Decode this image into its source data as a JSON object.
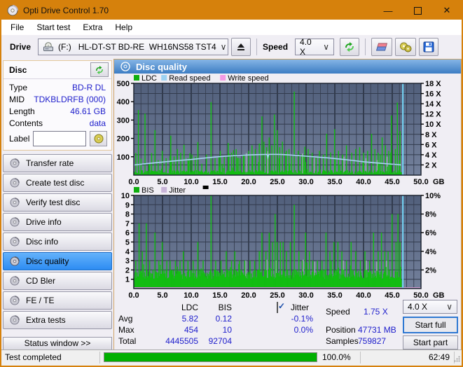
{
  "window": {
    "title": "Opti Drive Control 1.70"
  },
  "icons": {
    "minimize": "—",
    "close": "✕",
    "chevron": "∨"
  },
  "menu": {
    "items": [
      "File",
      "Start test",
      "Extra",
      "Help"
    ]
  },
  "toolbar": {
    "drive_label": "Drive",
    "drive_value": "(F:)   HL-DT-ST BD-RE  WH16NS58 TST4",
    "speed_label": "Speed",
    "speed_value": "4.0 X"
  },
  "disc_panel": {
    "title": "Disc",
    "rows": [
      {
        "label": "Type",
        "value": "BD-R DL"
      },
      {
        "label": "MID",
        "value": "TDKBLDRFB (000)"
      },
      {
        "label": "Length",
        "value": "46.61 GB"
      },
      {
        "label": "Contents",
        "value": "data"
      }
    ],
    "label_row": {
      "label": "Label",
      "value": ""
    }
  },
  "sidebar": {
    "buttons": [
      {
        "label": "Transfer rate",
        "active": false
      },
      {
        "label": "Create test disc",
        "active": false
      },
      {
        "label": "Verify test disc",
        "active": false
      },
      {
        "label": "Drive info",
        "active": false
      },
      {
        "label": "Disc info",
        "active": false
      },
      {
        "label": "Disc quality",
        "active": true
      },
      {
        "label": "CD Bler",
        "active": false
      },
      {
        "label": "FE / TE",
        "active": false
      },
      {
        "label": "Extra tests",
        "active": false
      }
    ],
    "status_window_label": "Status window >>"
  },
  "content_header": {
    "title": "Disc quality"
  },
  "colors": {
    "accent_orange": "#d6810c",
    "chart_bg_top": "#515f7b",
    "chart_bg_bottom": "#73809b",
    "grid_minor": "#3a4356",
    "grid_major": "#232b3a",
    "grid_h": "#323b4d",
    "plot_border": "#1d2532",
    "bar_green": "#12bd12",
    "gray_bar": "#98a0b2",
    "jitter_bar": "#a79cc0",
    "read_speed_line": "#a5d5f0",
    "end_line": "#74d6f7",
    "jitter_pink": "#cf9fd0",
    "value_blue": "#2020cc",
    "progress_green": "#00b000"
  },
  "chart_data": [
    {
      "name": "ldc-read-speed-chart",
      "type": "bar",
      "legend": [
        {
          "label": "LDC",
          "color": "#0faf0f"
        },
        {
          "label": "Read speed",
          "color": "#9ed2f2"
        },
        {
          "label": "Write speed",
          "color": "#f59ae4"
        }
      ],
      "legend_marker": false,
      "xlim": [
        0,
        50
      ],
      "x_major_ticks": [
        0,
        5,
        10,
        15,
        20,
        25,
        30,
        35,
        40,
        45,
        50
      ],
      "x_tick_labels": [
        "0.0",
        "5.0",
        "10.0",
        "15.0",
        "20.0",
        "25.0",
        "30.0",
        "35.0",
        "40.0",
        "45.0",
        "50.0"
      ],
      "x_unit": "GB",
      "x_minor_step": 1.25,
      "left_axis": {
        "max": 500,
        "ticks": [
          500,
          400,
          300,
          200,
          100
        ],
        "suffix": ""
      },
      "right_axis": {
        "max": 18,
        "ticks": [
          18,
          16,
          14,
          12,
          10,
          8,
          6,
          4,
          2
        ],
        "suffix": " X"
      },
      "grid_rows": 9,
      "data_end": 46.6,
      "end_line_x": 46.85,
      "bar_step": 0.115,
      "noise": {
        "seed": 20,
        "base_min": 5,
        "base_var": 22,
        "spike_prob": 0.14,
        "spike_var": 120
      },
      "spikes": [
        [
          0.3,
          120
        ],
        [
          0.8,
          355
        ],
        [
          1.3,
          90
        ],
        [
          2.0,
          335
        ],
        [
          2.6,
          62
        ],
        [
          3.1,
          120
        ],
        [
          3.7,
          245
        ],
        [
          4.3,
          82
        ],
        [
          5.0,
          132
        ],
        [
          5.6,
          92
        ],
        [
          6.4,
          215
        ],
        [
          7.0,
          102
        ],
        [
          7.6,
          142
        ],
        [
          8.2,
          122
        ],
        [
          8.7,
          165
        ],
        [
          9.4,
          92
        ],
        [
          10.1,
          112
        ],
        [
          10.7,
          100
        ],
        [
          11.2,
          180
        ],
        [
          11.9,
          62
        ],
        [
          12.6,
          112
        ],
        [
          13.5,
          398
        ],
        [
          14.2,
          92
        ],
        [
          15.1,
          132
        ],
        [
          15.8,
          102
        ],
        [
          16.4,
          175
        ],
        [
          17.0,
          122
        ],
        [
          17.8,
          142
        ],
        [
          18.5,
          92
        ],
        [
          19.2,
          112
        ],
        [
          20.0,
          132
        ],
        [
          20.6,
          162
        ],
        [
          21.2,
          142
        ],
        [
          21.8,
          172
        ],
        [
          22.3,
          320
        ],
        [
          22.7,
          182
        ],
        [
          23.1,
          152
        ],
        [
          23.6,
          205
        ],
        [
          24.0,
          162
        ],
        [
          24.5,
          330
        ],
        [
          24.9,
          245
        ],
        [
          25.4,
          152
        ],
        [
          25.9,
          182
        ],
        [
          26.5,
          122
        ],
        [
          27.0,
          142
        ],
        [
          27.5,
          102
        ],
        [
          28.0,
          455
        ],
        [
          28.6,
          132
        ],
        [
          29.2,
          112
        ],
        [
          29.8,
          155
        ],
        [
          30.4,
          142
        ],
        [
          31.0,
          122
        ],
        [
          31.7,
          102
        ],
        [
          32.3,
          132
        ],
        [
          33.0,
          112
        ],
        [
          33.6,
          225
        ],
        [
          34.3,
          122
        ],
        [
          35.0,
          250
        ],
        [
          35.7,
          132
        ],
        [
          36.3,
          112
        ],
        [
          37.0,
          162
        ],
        [
          37.9,
          122
        ],
        [
          38.6,
          142
        ],
        [
          39.3,
          152
        ],
        [
          40.0,
          122
        ],
        [
          40.7,
          132
        ],
        [
          41.4,
          225
        ],
        [
          42.0,
          142
        ],
        [
          42.6,
          122
        ],
        [
          43.2,
          205
        ],
        [
          43.8,
          162
        ],
        [
          44.4,
          132
        ],
        [
          44.9,
          325
        ],
        [
          45.5,
          142
        ],
        [
          45.9,
          395
        ],
        [
          46.3,
          240
        ]
      ],
      "gray_bars": [
        [
          19.6,
          120
        ],
        [
          23.3,
          130
        ],
        [
          29.4,
          118
        ],
        [
          31.4,
          92
        ],
        [
          36.6,
          100
        ],
        [
          40.4,
          92
        ],
        [
          42.4,
          82
        ],
        [
          44.1,
          100
        ]
      ],
      "line_points": [
        [
          0,
          55
        ],
        [
          1,
          58
        ],
        [
          2,
          62
        ],
        [
          4,
          68
        ],
        [
          6,
          74
        ],
        [
          8,
          80
        ],
        [
          10,
          85
        ],
        [
          12,
          92
        ],
        [
          14,
          98
        ],
        [
          16,
          103
        ],
        [
          18,
          107
        ],
        [
          20,
          110
        ],
        [
          22,
          112
        ],
        [
          23.2,
          113
        ],
        [
          23.35,
          96
        ],
        [
          23.5,
          113
        ],
        [
          25,
          113
        ],
        [
          26,
          112
        ],
        [
          28,
          108
        ],
        [
          30,
          103
        ],
        [
          32,
          98
        ],
        [
          34,
          93
        ],
        [
          36,
          87
        ],
        [
          38,
          80
        ],
        [
          40,
          73
        ],
        [
          42,
          67
        ],
        [
          44,
          62
        ],
        [
          46,
          57
        ],
        [
          46.6,
          55
        ]
      ]
    },
    {
      "name": "bis-jitter-chart",
      "type": "bar",
      "legend": [
        {
          "label": "BIS",
          "color": "#0faf0f"
        },
        {
          "label": "Jitter",
          "color": "#c8b4d8"
        }
      ],
      "legend_marker": true,
      "xlim": [
        0,
        50
      ],
      "x_major_ticks": [
        0,
        5,
        10,
        15,
        20,
        25,
        30,
        35,
        40,
        45,
        50
      ],
      "x_tick_labels": [
        "0.0",
        "5.0",
        "10.0",
        "15.0",
        "20.0",
        "25.0",
        "30.0",
        "35.0",
        "40.0",
        "45.0",
        "50.0"
      ],
      "x_unit": "GB",
      "x_minor_step": 1.25,
      "left_axis": {
        "max": 10,
        "ticks": [
          10,
          9,
          8,
          7,
          6,
          5,
          4,
          3,
          2,
          1
        ],
        "suffix": ""
      },
      "right_axis": {
        "max": 10,
        "ticks": [
          10,
          8,
          6,
          4,
          2
        ],
        "suffix": "%"
      },
      "grid_rows": 10,
      "data_end": 46.6,
      "end_line_x": 46.85,
      "bar_step": 0.115,
      "noise": {
        "seed": 9,
        "base_min": 1.0,
        "base_var": 1.05,
        "spike_prob": 0.1,
        "spike_var": 1.4
      },
      "spikes": [
        [
          0.3,
          3
        ],
        [
          0.9,
          7
        ],
        [
          1.5,
          4
        ],
        [
          2.2,
          7
        ],
        [
          2.8,
          3
        ],
        [
          3.7,
          6
        ],
        [
          4.4,
          3
        ],
        [
          5.0,
          5
        ],
        [
          5.7,
          3
        ],
        [
          6.3,
          3
        ],
        [
          7.2,
          3
        ],
        [
          8.0,
          3
        ],
        [
          8.6,
          4
        ],
        [
          9.4,
          3
        ],
        [
          10.3,
          3
        ],
        [
          11.2,
          5
        ],
        [
          12.1,
          3
        ],
        [
          13.5,
          10
        ],
        [
          14.3,
          3
        ],
        [
          15.2,
          3
        ],
        [
          16.1,
          4
        ],
        [
          17.0,
          3
        ],
        [
          17.6,
          4
        ],
        [
          18.4,
          3
        ],
        [
          19.3,
          3
        ],
        [
          20.2,
          3
        ],
        [
          21.0,
          3
        ],
        [
          21.8,
          4
        ],
        [
          22.3,
          6
        ],
        [
          23.0,
          4
        ],
        [
          23.6,
          6
        ],
        [
          24.1,
          5
        ],
        [
          24.6,
          8
        ],
        [
          25.0,
          5
        ],
        [
          25.5,
          5
        ],
        [
          26.0,
          5
        ],
        [
          26.6,
          4
        ],
        [
          27.2,
          5
        ],
        [
          28.0,
          9
        ],
        [
          28.7,
          4
        ],
        [
          29.3,
          3
        ],
        [
          29.9,
          6
        ],
        [
          30.6,
          4
        ],
        [
          31.2,
          3
        ],
        [
          32.0,
          3
        ],
        [
          32.8,
          3
        ],
        [
          33.5,
          6
        ],
        [
          34.2,
          4
        ],
        [
          34.9,
          5
        ],
        [
          35.5,
          5
        ],
        [
          36.2,
          4
        ],
        [
          37.0,
          3
        ],
        [
          37.8,
          5
        ],
        [
          38.6,
          4
        ],
        [
          39.4,
          3
        ],
        [
          40.2,
          4
        ],
        [
          41.0,
          3
        ],
        [
          41.8,
          6
        ],
        [
          42.5,
          4
        ],
        [
          43.1,
          6
        ],
        [
          43.7,
          4
        ],
        [
          44.3,
          4
        ],
        [
          45.0,
          8
        ],
        [
          45.6,
          5
        ],
        [
          46.0,
          8
        ],
        [
          46.4,
          5
        ]
      ],
      "gray_bars": [
        [
          19.5,
          3
        ],
        [
          23.2,
          3.1
        ],
        [
          24.8,
          3
        ],
        [
          29.5,
          3.1
        ],
        [
          31.5,
          2.9
        ],
        [
          36.5,
          3
        ],
        [
          40.5,
          3
        ],
        [
          42.3,
          2.9
        ],
        [
          44.0,
          3
        ]
      ],
      "baseline_line": {
        "value": 0.08,
        "color": "#cf9fd0"
      }
    }
  ],
  "stats": {
    "col1_header": "LDC",
    "col2_header": "BIS",
    "row_labels": [
      "Avg",
      "Max",
      "Total"
    ],
    "ldc": [
      "5.82",
      "454",
      "4445505"
    ],
    "bis": [
      "0.12",
      "10",
      "92704"
    ],
    "jitter_label": "Jitter",
    "jitter_checked": true,
    "jitter_values": [
      "-0.1%",
      "0.0%"
    ],
    "speed_label": "Speed",
    "speed_value": "1.75 X",
    "position_label": "Position",
    "position_value": "47731 MB",
    "samples_label": "Samples",
    "samples_value": "759827",
    "speed_select_value": "4.0 X",
    "start_full_label": "Start full",
    "start_part_label": "Start part"
  },
  "statusbar": {
    "status": "Test completed",
    "percent": "100.0%",
    "time": "62:49",
    "progress_value": 1
  }
}
